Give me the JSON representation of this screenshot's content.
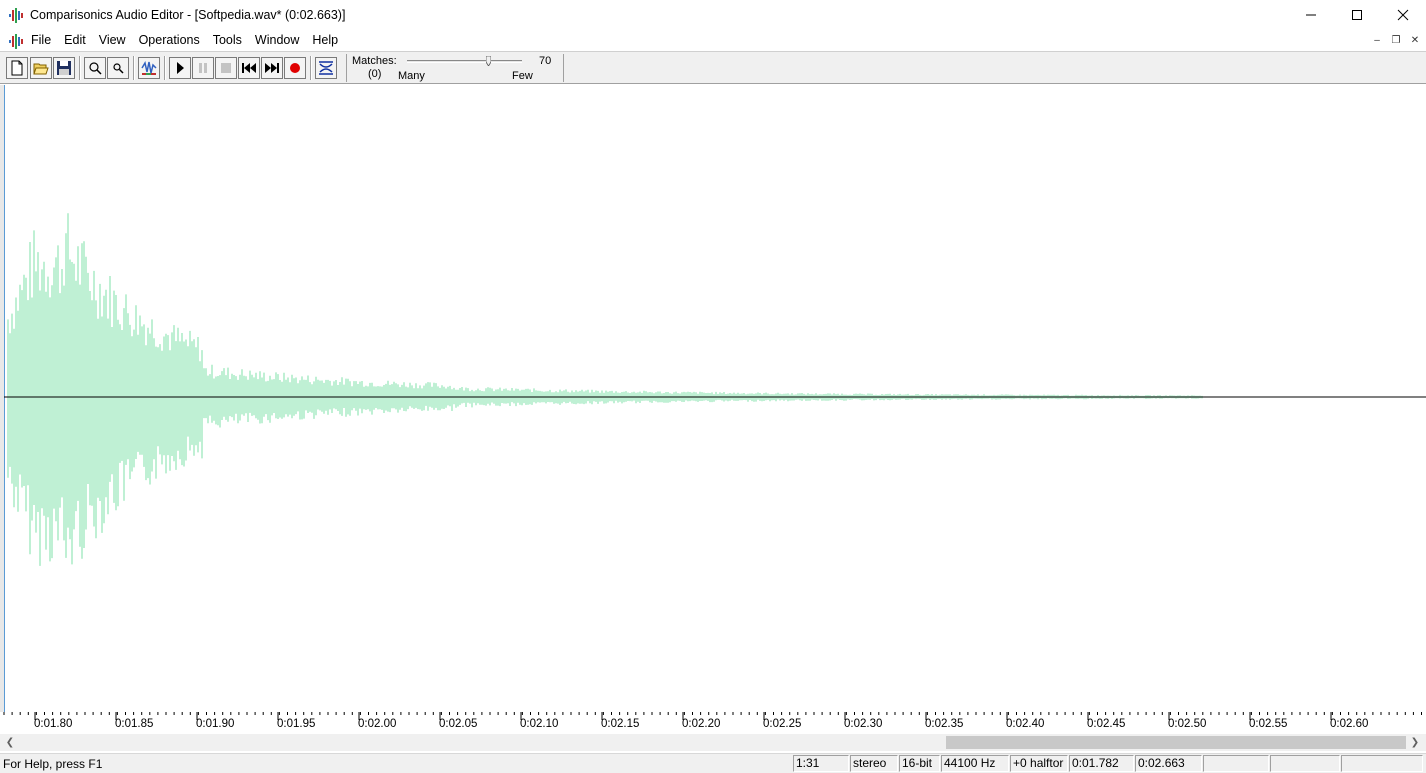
{
  "window": {
    "title": "Comparisonics Audio Editor - [Softpedia.wav* (0:02.663)]"
  },
  "menu": {
    "items": [
      "File",
      "Edit",
      "View",
      "Operations",
      "Tools",
      "Window",
      "Help"
    ]
  },
  "toolbar": {
    "buttons": [
      "new-file",
      "open-file",
      "save-file",
      "zoom-in",
      "zoom-out",
      "comparisonics-color",
      "play",
      "pause",
      "stop",
      "rewind",
      "fast-forward",
      "record",
      "find-matches"
    ]
  },
  "matches": {
    "label": "Matches:",
    "count": "(0)",
    "value": "70",
    "min_label": "Many",
    "max_label": "Few"
  },
  "ruler": {
    "ticks": [
      "0:01.80",
      "0:01.85",
      "0:01.90",
      "0:01.95",
      "0:02.00",
      "0:02.05",
      "0:02.10",
      "0:02.15",
      "0:02.20",
      "0:02.25",
      "0:02.30",
      "0:02.35",
      "0:02.40",
      "0:02.45",
      "0:02.50",
      "0:02.55",
      "0:02.60"
    ]
  },
  "waveform": {
    "color": "#7fe0a8",
    "centerline_color": "#000000"
  },
  "status": {
    "help_text": "For Help, press F1",
    "zoom": "1:31",
    "channels": "stereo",
    "bit_depth": "16-bit",
    "sample_rate": "44100 Hz",
    "pitch": "+0 halftor",
    "cursor_time": "0:01.782",
    "total_time": "0:02.663"
  }
}
